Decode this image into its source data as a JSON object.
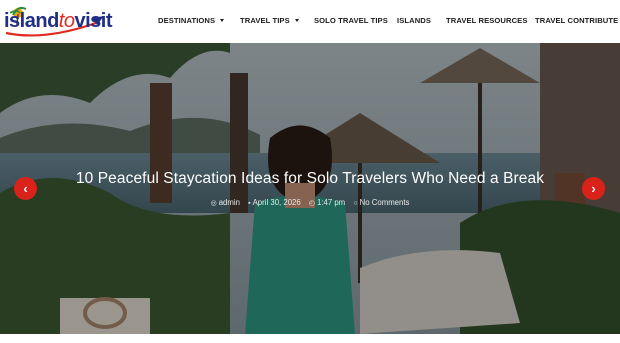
{
  "brand": {
    "logo_word_1": "island",
    "logo_word_2": "to",
    "logo_word_3": "visit"
  },
  "nav": {
    "items": [
      {
        "label": "DESTINATIONS",
        "dropdown": true
      },
      {
        "label": "TRAVEL TIPS",
        "dropdown": true
      },
      {
        "label": "SOLO TRAVEL TIPS",
        "dropdown": false
      },
      {
        "label": "ISLANDS",
        "dropdown": false
      },
      {
        "label": "TRAVEL RESOURCES",
        "dropdown": false
      },
      {
        "label": "TRAVEL CONTRIBUTE",
        "dropdown": false
      }
    ]
  },
  "hero": {
    "title": "10 Peaceful Staycation Ideas for Solo Travelers Who Need a Break",
    "meta": {
      "author": "admin",
      "date": "April 30, 2026",
      "time": "1:47 pm",
      "comments": "No Comments"
    },
    "prev_icon": "chevron-left-icon",
    "next_icon": "chevron-right-icon"
  },
  "colors": {
    "accent": "#d8221a",
    "brand_blue": "#1f2f86",
    "brand_red": "#e02b20"
  }
}
